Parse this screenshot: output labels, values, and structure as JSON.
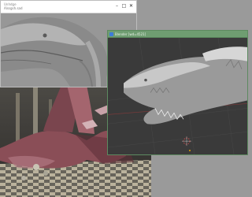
{
  "windows": {
    "top": {
      "title": "Unhdge",
      "subtitle": "Alssgsh.sad"
    },
    "right": {
      "title": "Blender [wd=4521]",
      "icon": "blender-icon"
    },
    "bottom": {
      "title": ""
    }
  },
  "controls": {
    "minimize": "–",
    "maximize": "□",
    "close": "✕"
  },
  "colors": {
    "sculpt_grey": "#8e8e8e",
    "viewport_dark": "#3b3b3b",
    "right_titlebar": "#6f9d71",
    "creature_red": "#9c5e66"
  }
}
